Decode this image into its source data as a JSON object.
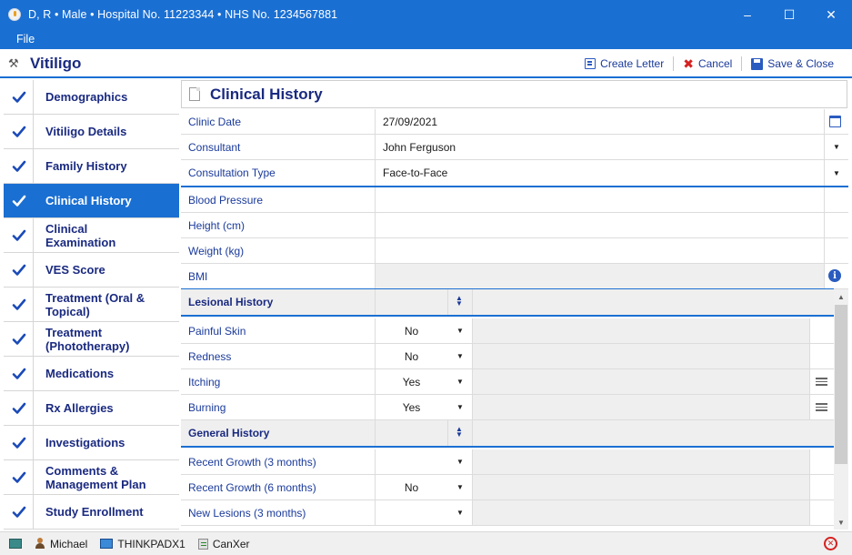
{
  "window": {
    "title": "D, R • Male • Hospital No. 11223344 • NHS No. 1234567881",
    "controls": {
      "minimize": "–",
      "maximize": "☐",
      "close": "✕"
    }
  },
  "menu": {
    "file": "File"
  },
  "header": {
    "title": "Vitiligo",
    "actions": {
      "create_letter": "Create Letter",
      "cancel": "Cancel",
      "save_close": "Save & Close"
    }
  },
  "sidebar": {
    "items": [
      {
        "label": "Demographics",
        "checked": true,
        "active": false
      },
      {
        "label": "Vitiligo Details",
        "checked": true,
        "active": false
      },
      {
        "label": "Family History",
        "checked": true,
        "active": false
      },
      {
        "label": "Clinical History",
        "checked": true,
        "active": true
      },
      {
        "label": "Clinical Examination",
        "checked": true,
        "active": false
      },
      {
        "label": "VES Score",
        "checked": true,
        "active": false
      },
      {
        "label": "Treatment (Oral & Topical)",
        "checked": true,
        "active": false
      },
      {
        "label": "Treatment (Phototherapy)",
        "checked": true,
        "active": false
      },
      {
        "label": "Medications",
        "checked": true,
        "active": false
      },
      {
        "label": "Rx Allergies",
        "checked": true,
        "active": false
      },
      {
        "label": "Investigations",
        "checked": true,
        "active": false
      },
      {
        "label": "Comments & Management Plan",
        "checked": true,
        "active": false
      },
      {
        "label": "Study Enrollment",
        "checked": true,
        "active": false
      }
    ]
  },
  "section": {
    "title": "Clinical History",
    "top_fields": [
      {
        "label": "Clinic Date",
        "value": "27/09/2021",
        "widget": "calendar-icon"
      },
      {
        "label": "Consultant",
        "value": "John Ferguson",
        "widget": "dropdown"
      },
      {
        "label": "Consultation Type",
        "value": "Face-to-Face",
        "widget": "dropdown"
      }
    ],
    "measurements": [
      {
        "label": "Blood Pressure",
        "value": ""
      },
      {
        "label": "Height (cm)",
        "value": ""
      },
      {
        "label": "Weight (kg)",
        "value": ""
      },
      {
        "label": "BMI",
        "value": "",
        "widget": "info-icon"
      }
    ],
    "lesional_history": {
      "title": "Lesional History",
      "rows": [
        {
          "label": "Painful Skin",
          "value": "No",
          "note": false
        },
        {
          "label": "Redness",
          "value": "No",
          "note": false
        },
        {
          "label": "Itching",
          "value": "Yes",
          "note": true
        },
        {
          "label": "Burning",
          "value": "Yes",
          "note": true
        }
      ]
    },
    "general_history": {
      "title": "General History",
      "rows": [
        {
          "label": "Recent Growth (3 months)",
          "value": ""
        },
        {
          "label": "Recent Growth (6 months)",
          "value": "No"
        },
        {
          "label": "New Lesions (3 months)",
          "value": ""
        }
      ]
    }
  },
  "statusbar": {
    "user": "Michael",
    "machine": "THINKPADX1",
    "app": "CanXer"
  },
  "colors": {
    "accent": "#1a6fd2",
    "nav_text": "#1a2a80",
    "label_text": "#1a3a9a",
    "cancel": "#d62020"
  }
}
